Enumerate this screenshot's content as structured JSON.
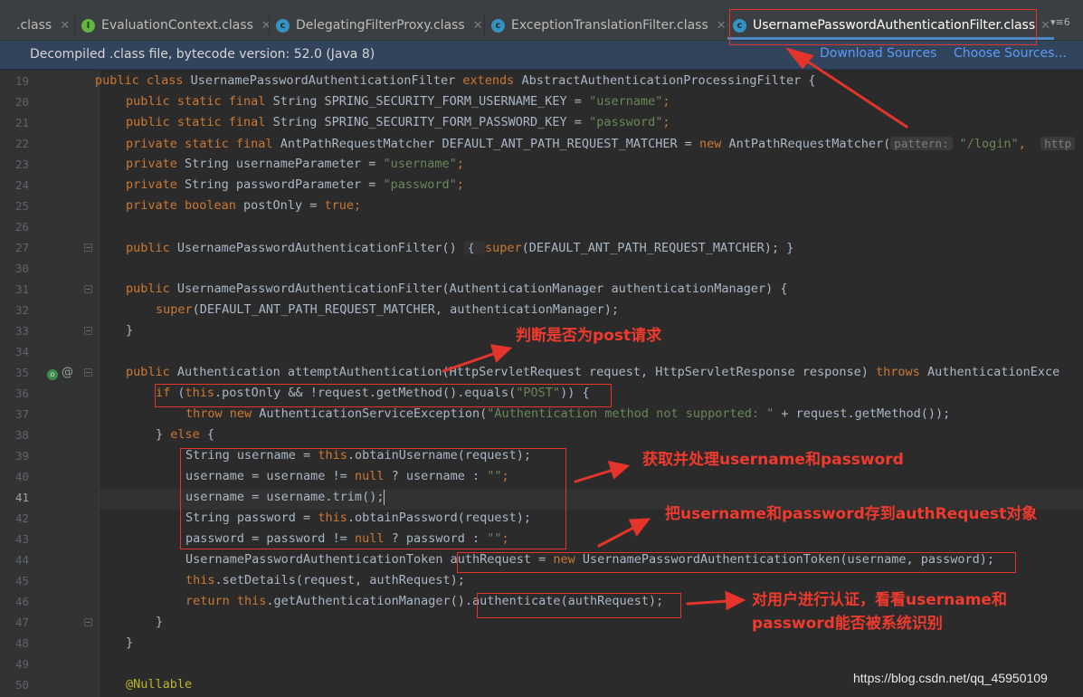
{
  "tabs": [
    {
      "label": ".class",
      "icon": "class-file-icon",
      "active": false
    },
    {
      "label": "EvaluationContext.class",
      "icon": "interface-file-icon",
      "active": false
    },
    {
      "label": "DelegatingFilterProxy.class",
      "icon": "class-file-icon",
      "active": false
    },
    {
      "label": "ExceptionTranslationFilter.class",
      "icon": "class-file-icon",
      "active": false
    },
    {
      "label": "UsernamePasswordAuthenticationFilter.class",
      "icon": "class-file-icon",
      "active": true
    }
  ],
  "tab_menu_label": "▾≡6",
  "banner": {
    "text": "Decompiled .class file, bytecode version: 52.0 (Java 8)",
    "download_sources": "Download Sources",
    "choose_sources": "Choose Sources..."
  },
  "code": {
    "line_numbers": [
      "19",
      "20",
      "21",
      "22",
      "23",
      "24",
      "25",
      "26",
      "27",
      "30",
      "31",
      "32",
      "33",
      "34",
      "35",
      "36",
      "37",
      "38",
      "39",
      "40",
      "41",
      "42",
      "43",
      "44",
      "45",
      "46",
      "47",
      "48",
      "49",
      "50"
    ],
    "current_line": "41",
    "l19": {
      "kw1": "public class ",
      "name": "UsernamePasswordAuthenticationFilter ",
      "kw2": "extends ",
      "parent": "AbstractAuthenticationProcessingFilter {"
    },
    "l20": {
      "kw": "public static final ",
      "decl": "String SPRING_SECURITY_FORM_USERNAME_KEY = ",
      "str": "\"username\"",
      "end": ";"
    },
    "l21": {
      "kw": "public static final ",
      "decl": "String SPRING_SECURITY_FORM_PASSWORD_KEY = ",
      "str": "\"password\"",
      "end": ";"
    },
    "l22": {
      "kw": "private static final ",
      "decl": "AntPathRequestMatcher DEFAULT_ANT_PATH_REQUEST_MATCHER = ",
      "kw2": "new ",
      "call": "AntPathRequestMatcher(",
      "hint1": "pattern:",
      "str": " \"/login\"",
      "rest": ",  ",
      "hint2": "http"
    },
    "l23": {
      "kw": "private ",
      "decl": "String usernameParameter = ",
      "str": "\"username\"",
      "end": ";"
    },
    "l24": {
      "kw": "private ",
      "decl": "String passwordParameter = ",
      "str": "\"password\"",
      "end": ";"
    },
    "l25": {
      "kw": "private boolean ",
      "decl": "postOnly = ",
      "kw2": "true",
      "end": ";"
    },
    "l27": {
      "kw": "public ",
      "decl": "UsernamePasswordAuthenticationFilter() ",
      "b1": "{ ",
      "kw2": "super",
      "call": "(DEFAULT_ANT_PATH_REQUEST_MATCHER)",
      "end": "; }"
    },
    "l31": {
      "kw": "public ",
      "decl": "UsernamePasswordAuthenticationFilter(AuthenticationManager authenticationManager) {"
    },
    "l32": {
      "kw": "super",
      "rest": "(DEFAULT_ANT_PATH_REQUEST_MATCHER, authenticationManager);"
    },
    "l33": "}",
    "l35": {
      "kw": "public ",
      "decl": "Authentication attemptAuthentication(HttpServletRequest request, HttpServletResponse response) ",
      "kw2": "throws ",
      "rest": "AuthenticationExce"
    },
    "l36": {
      "kw": "if ",
      "a": "(",
      "kw2": "this",
      "b": ".postOnly && !request.getMethod().equals(",
      "str": "\"POST\"",
      "c": ")) {"
    },
    "l37": {
      "kw": "throw new ",
      "call": "AuthenticationServiceException(",
      "str": "\"Authentication method not supported: \"",
      "rest": " + request.getMethod());"
    },
    "l38": {
      "a": "} ",
      "kw": "else ",
      "b": "{"
    },
    "l39": {
      "a": "String username = ",
      "kw": "this",
      "b": ".obtainUsername(request);"
    },
    "l40": {
      "a": "username = username != ",
      "kw": "null ",
      "b": "? username : ",
      "str": "\"\"",
      "c": ";"
    },
    "l41": {
      "a": "username = username.trim();"
    },
    "l42": {
      "a": "String password = ",
      "kw": "this",
      "b": ".obtainPassword(request);"
    },
    "l43": {
      "a": "password = password != ",
      "kw": "null ",
      "b": "? password : ",
      "str": "\"\"",
      "c": ";"
    },
    "l44": {
      "a": "UsernamePasswordAuthenticationToken authRequest = ",
      "kw": "new ",
      "b": "UsernamePasswordAuthenticationToken(username, password);"
    },
    "l45": {
      "kw": "this",
      "a": ".setDetails(request, authRequest);"
    },
    "l46": {
      "kw": "return this",
      "a": ".getAuthenticationManager().authenticate(authRequest);"
    },
    "l47": "}",
    "l48": "}",
    "l50": "@Nullable"
  },
  "annotations": {
    "post_check": "判断是否为post请求",
    "get_username_password": "获取并处理username和password",
    "store_auth_request": "把username和password存到authRequest对象",
    "authenticate_line1": "对用户进行认证，看看username和",
    "authenticate_line2": "password能否被系统识别"
  },
  "watermark": "https://blog.csdn.net/qq_45950109",
  "colors": {
    "annotation_red": "#e4342b",
    "keyword": "#cc7832",
    "string": "#6a8759",
    "link": "#589df6"
  }
}
